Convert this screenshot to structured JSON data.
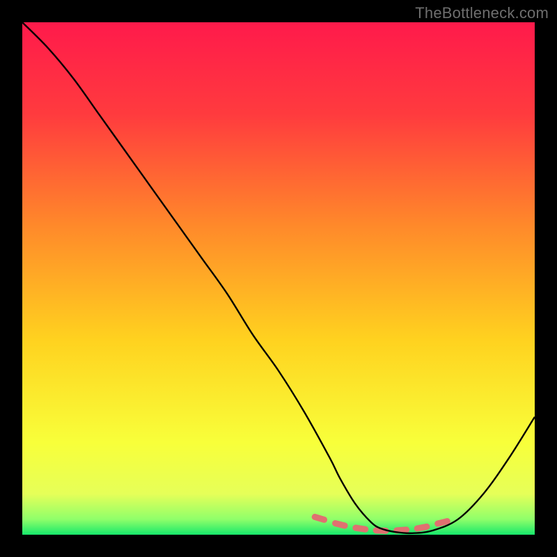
{
  "watermark": "TheBottleneck.com",
  "chart_data": {
    "type": "line",
    "title": "",
    "xlabel": "",
    "ylabel": "",
    "xlim": [
      0,
      100
    ],
    "ylim": [
      0,
      100
    ],
    "series": [
      {
        "name": "curve",
        "x": [
          0,
          5,
          10,
          15,
          20,
          25,
          30,
          35,
          40,
          45,
          50,
          55,
          60,
          62,
          65,
          68,
          70,
          73,
          76,
          80,
          85,
          90,
          95,
          100
        ],
        "values": [
          100,
          95,
          89,
          82,
          75,
          68,
          61,
          54,
          47,
          39,
          32,
          24,
          15,
          11,
          6,
          2.5,
          1.2,
          0.5,
          0.3,
          0.8,
          3,
          8,
          15,
          23
        ]
      }
    ],
    "markers": {
      "name": "highlight-dashes",
      "x": [
        58,
        62,
        66,
        70,
        74,
        78,
        82
      ],
      "values": [
        3.2,
        2.0,
        1.2,
        0.8,
        0.9,
        1.4,
        2.4
      ]
    },
    "gradient_stops": [
      {
        "offset": 0,
        "color": "#ff1a4b"
      },
      {
        "offset": 18,
        "color": "#ff3b3e"
      },
      {
        "offset": 40,
        "color": "#ff8a2a"
      },
      {
        "offset": 62,
        "color": "#ffd21f"
      },
      {
        "offset": 82,
        "color": "#f8ff3a"
      },
      {
        "offset": 92,
        "color": "#e6ff58"
      },
      {
        "offset": 97,
        "color": "#8fff6a"
      },
      {
        "offset": 100,
        "color": "#17e86b"
      }
    ],
    "curve_color": "#000000",
    "marker_color": "#e07070",
    "marker_thickness": 9
  }
}
